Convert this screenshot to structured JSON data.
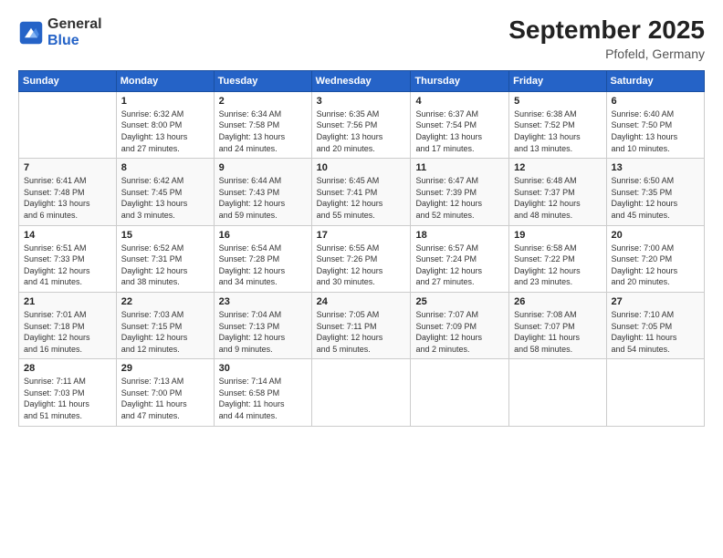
{
  "logo": {
    "general": "General",
    "blue": "Blue"
  },
  "title": "September 2025",
  "location": "Pfofeld, Germany",
  "days_header": [
    "Sunday",
    "Monday",
    "Tuesday",
    "Wednesday",
    "Thursday",
    "Friday",
    "Saturday"
  ],
  "weeks": [
    [
      {
        "day": "",
        "info": ""
      },
      {
        "day": "1",
        "info": "Sunrise: 6:32 AM\nSunset: 8:00 PM\nDaylight: 13 hours\nand 27 minutes."
      },
      {
        "day": "2",
        "info": "Sunrise: 6:34 AM\nSunset: 7:58 PM\nDaylight: 13 hours\nand 24 minutes."
      },
      {
        "day": "3",
        "info": "Sunrise: 6:35 AM\nSunset: 7:56 PM\nDaylight: 13 hours\nand 20 minutes."
      },
      {
        "day": "4",
        "info": "Sunrise: 6:37 AM\nSunset: 7:54 PM\nDaylight: 13 hours\nand 17 minutes."
      },
      {
        "day": "5",
        "info": "Sunrise: 6:38 AM\nSunset: 7:52 PM\nDaylight: 13 hours\nand 13 minutes."
      },
      {
        "day": "6",
        "info": "Sunrise: 6:40 AM\nSunset: 7:50 PM\nDaylight: 13 hours\nand 10 minutes."
      }
    ],
    [
      {
        "day": "7",
        "info": "Sunrise: 6:41 AM\nSunset: 7:48 PM\nDaylight: 13 hours\nand 6 minutes."
      },
      {
        "day": "8",
        "info": "Sunrise: 6:42 AM\nSunset: 7:45 PM\nDaylight: 13 hours\nand 3 minutes."
      },
      {
        "day": "9",
        "info": "Sunrise: 6:44 AM\nSunset: 7:43 PM\nDaylight: 12 hours\nand 59 minutes."
      },
      {
        "day": "10",
        "info": "Sunrise: 6:45 AM\nSunset: 7:41 PM\nDaylight: 12 hours\nand 55 minutes."
      },
      {
        "day": "11",
        "info": "Sunrise: 6:47 AM\nSunset: 7:39 PM\nDaylight: 12 hours\nand 52 minutes."
      },
      {
        "day": "12",
        "info": "Sunrise: 6:48 AM\nSunset: 7:37 PM\nDaylight: 12 hours\nand 48 minutes."
      },
      {
        "day": "13",
        "info": "Sunrise: 6:50 AM\nSunset: 7:35 PM\nDaylight: 12 hours\nand 45 minutes."
      }
    ],
    [
      {
        "day": "14",
        "info": "Sunrise: 6:51 AM\nSunset: 7:33 PM\nDaylight: 12 hours\nand 41 minutes."
      },
      {
        "day": "15",
        "info": "Sunrise: 6:52 AM\nSunset: 7:31 PM\nDaylight: 12 hours\nand 38 minutes."
      },
      {
        "day": "16",
        "info": "Sunrise: 6:54 AM\nSunset: 7:28 PM\nDaylight: 12 hours\nand 34 minutes."
      },
      {
        "day": "17",
        "info": "Sunrise: 6:55 AM\nSunset: 7:26 PM\nDaylight: 12 hours\nand 30 minutes."
      },
      {
        "day": "18",
        "info": "Sunrise: 6:57 AM\nSunset: 7:24 PM\nDaylight: 12 hours\nand 27 minutes."
      },
      {
        "day": "19",
        "info": "Sunrise: 6:58 AM\nSunset: 7:22 PM\nDaylight: 12 hours\nand 23 minutes."
      },
      {
        "day": "20",
        "info": "Sunrise: 7:00 AM\nSunset: 7:20 PM\nDaylight: 12 hours\nand 20 minutes."
      }
    ],
    [
      {
        "day": "21",
        "info": "Sunrise: 7:01 AM\nSunset: 7:18 PM\nDaylight: 12 hours\nand 16 minutes."
      },
      {
        "day": "22",
        "info": "Sunrise: 7:03 AM\nSunset: 7:15 PM\nDaylight: 12 hours\nand 12 minutes."
      },
      {
        "day": "23",
        "info": "Sunrise: 7:04 AM\nSunset: 7:13 PM\nDaylight: 12 hours\nand 9 minutes."
      },
      {
        "day": "24",
        "info": "Sunrise: 7:05 AM\nSunset: 7:11 PM\nDaylight: 12 hours\nand 5 minutes."
      },
      {
        "day": "25",
        "info": "Sunrise: 7:07 AM\nSunset: 7:09 PM\nDaylight: 12 hours\nand 2 minutes."
      },
      {
        "day": "26",
        "info": "Sunrise: 7:08 AM\nSunset: 7:07 PM\nDaylight: 11 hours\nand 58 minutes."
      },
      {
        "day": "27",
        "info": "Sunrise: 7:10 AM\nSunset: 7:05 PM\nDaylight: 11 hours\nand 54 minutes."
      }
    ],
    [
      {
        "day": "28",
        "info": "Sunrise: 7:11 AM\nSunset: 7:03 PM\nDaylight: 11 hours\nand 51 minutes."
      },
      {
        "day": "29",
        "info": "Sunrise: 7:13 AM\nSunset: 7:00 PM\nDaylight: 11 hours\nand 47 minutes."
      },
      {
        "day": "30",
        "info": "Sunrise: 7:14 AM\nSunset: 6:58 PM\nDaylight: 11 hours\nand 44 minutes."
      },
      {
        "day": "",
        "info": ""
      },
      {
        "day": "",
        "info": ""
      },
      {
        "day": "",
        "info": ""
      },
      {
        "day": "",
        "info": ""
      }
    ]
  ]
}
